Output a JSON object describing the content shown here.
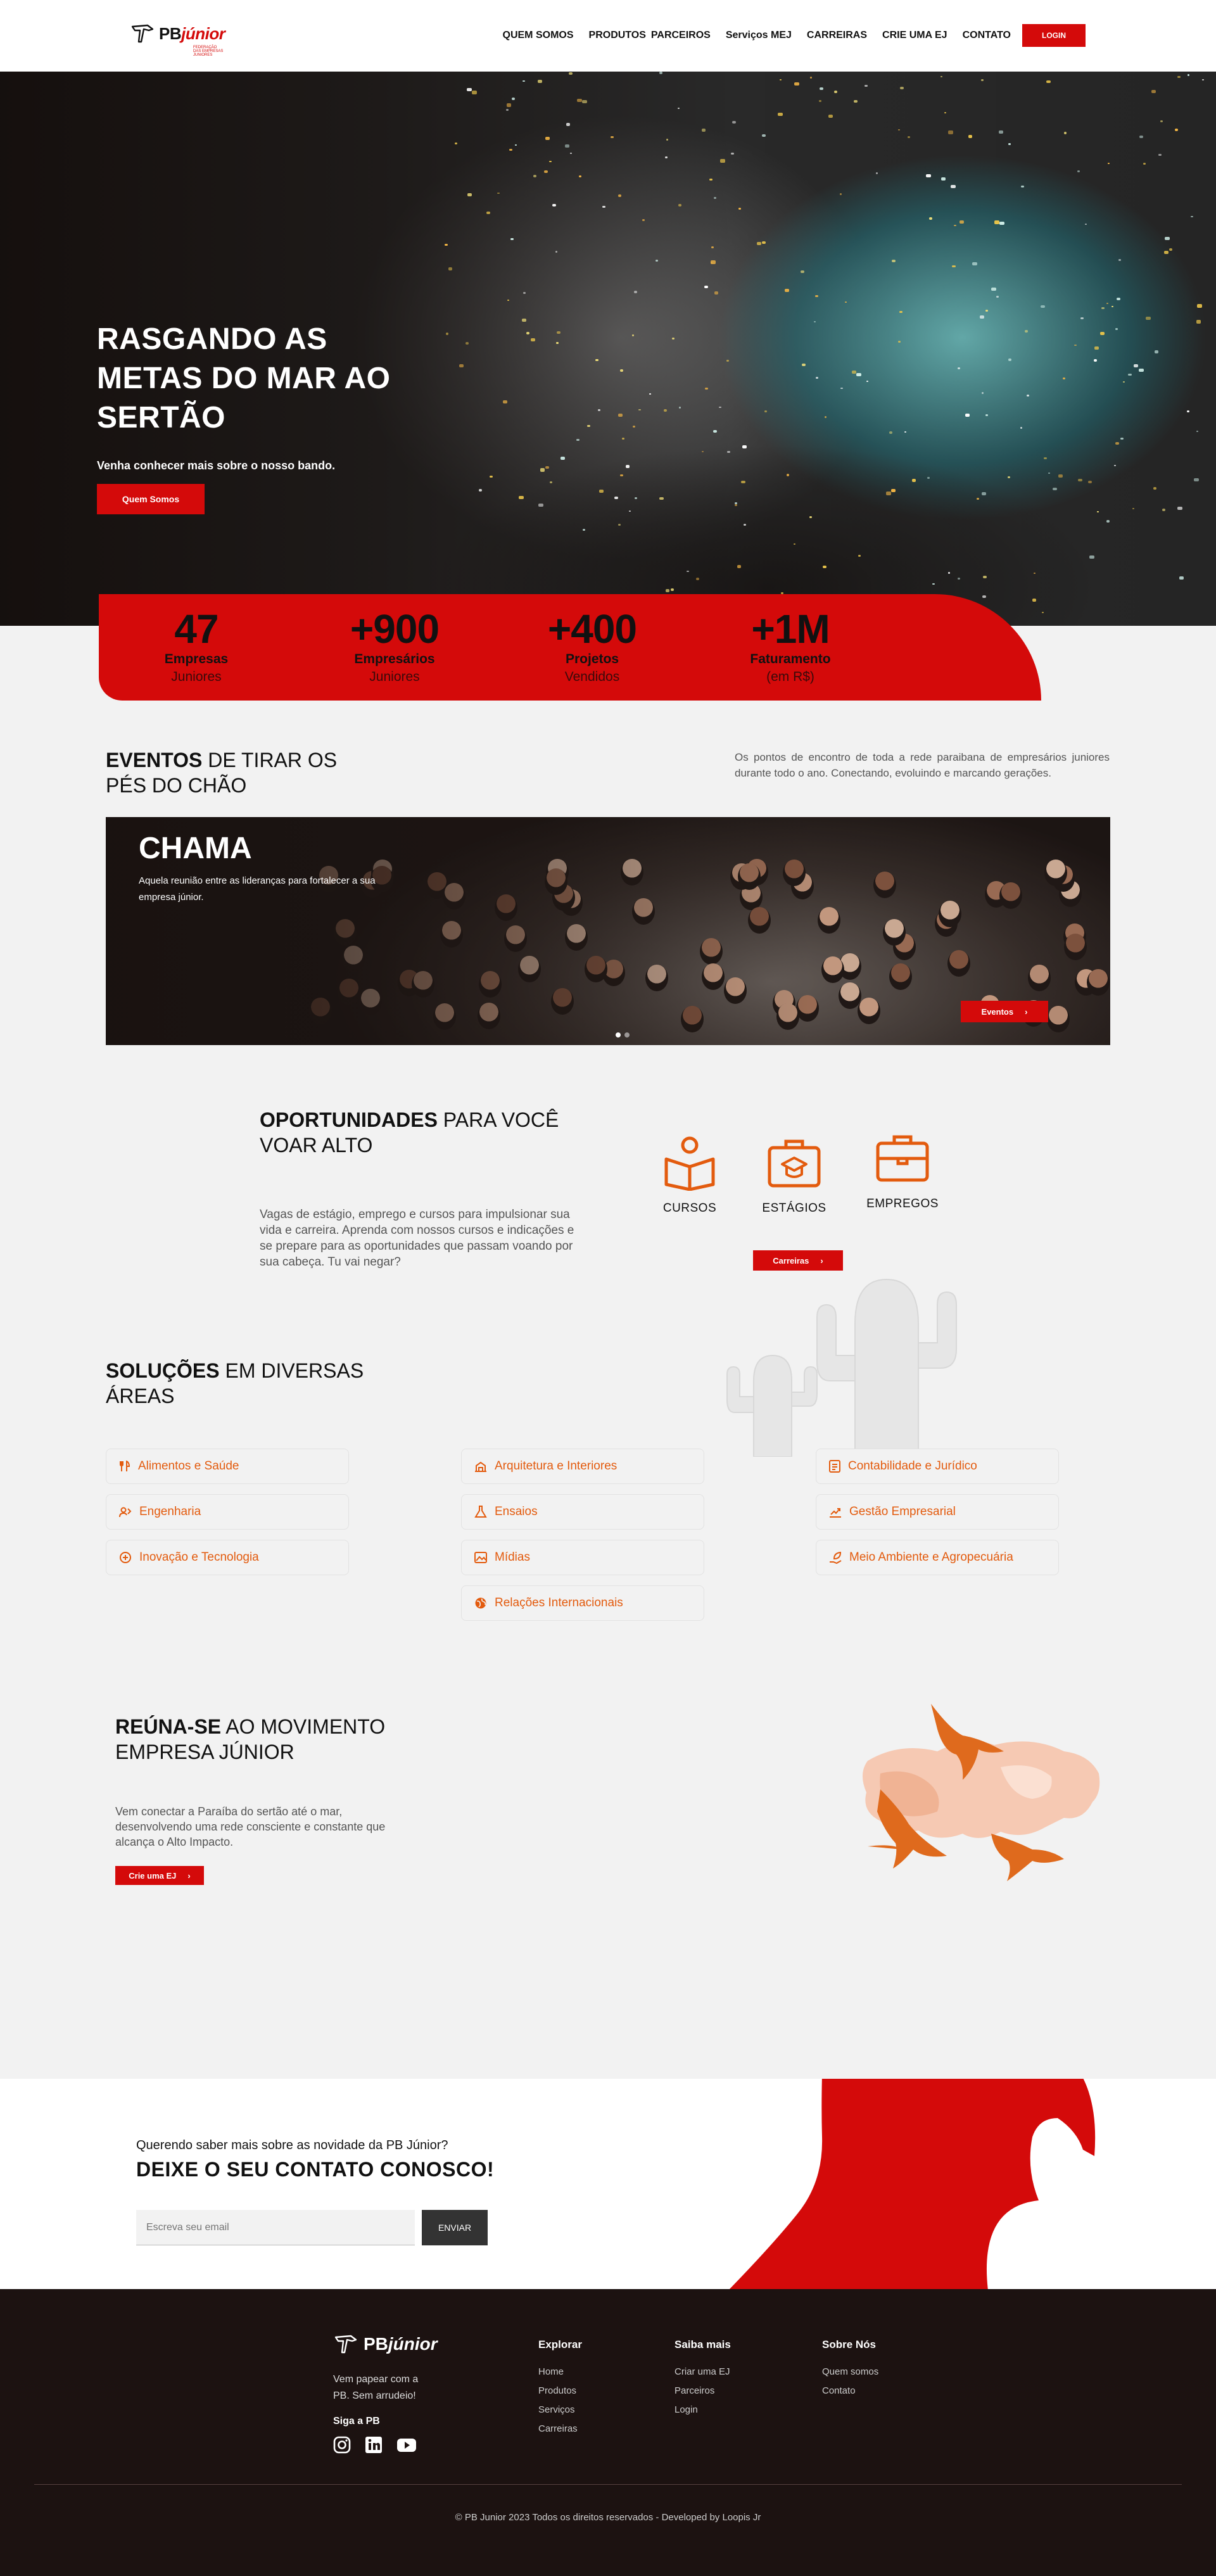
{
  "header": {
    "logo_text": "PB",
    "logo_accent": "júnior",
    "logo_tagline": "FEDERAÇÃO DAS EMPRESAS JUNIORES",
    "nav": [
      "QUEM SOMOS",
      "PRODUTOS",
      "PARCEIROS",
      "Serviços MEJ",
      "CARREIRAS",
      "CRIE UMA EJ",
      "CONTATO"
    ],
    "login": "LOGIN"
  },
  "hero": {
    "title": "RASGANDO AS METAS DO MAR AO SERTÃO",
    "subtitle": "Venha conhecer mais sobre o nosso bando.",
    "button": "Quem Somos"
  },
  "stats": [
    {
      "num": "47",
      "l1": "Empresas",
      "l2": "Juniores"
    },
    {
      "num": "+900",
      "l1": "Empresários",
      "l2": "Juniores"
    },
    {
      "num": "+400",
      "l1": "Projetos",
      "l2": "Vendidos"
    },
    {
      "num": "+1M",
      "l1": "Faturamento",
      "l2": "(em R$)"
    }
  ],
  "eventos": {
    "title_bold": "EVENTOS",
    "title_rest": " DE TIRAR OS PÉS DO CHÃO",
    "description": "Os pontos de encontro de toda a rede paraibana de empresários juniores durante todo o ano. Conectando, evoluindo e marcando gerações.",
    "slide_title": "CHAMA",
    "slide_text": "Aquela reunião entre as lideranças para fortalecer a sua empresa júnior.",
    "slide_button": "Eventos"
  },
  "oportunidades": {
    "title_bold": "OPORTUNIDADES",
    "title_rest": " PARA VOCÊ VOAR ALTO",
    "description": "Vagas de estágio, emprego e cursos para impulsionar sua vida e carreira. Aprenda com nossos cursos e indicações e se prepare para as oportunidades que passam voando por sua cabeça. Tu vai negar?",
    "items": [
      "CURSOS",
      "ESTÁGIOS",
      "EMPREGOS"
    ],
    "button": "Carreiras"
  },
  "solucoes": {
    "title_bold": "SOLUÇÕES",
    "title_rest": " EM DIVERSAS ÁREAS",
    "items": [
      "Alimentos e Saúde",
      "Engenharia",
      "Inovação e Tecnologia",
      "Arquitetura e Interiores",
      "Ensaios",
      "Mídias",
      "Relações Internacionais",
      "Contabilidade e Jurídico",
      "Gestão Empresarial",
      "Meio Ambiente e Agropecuária"
    ]
  },
  "reuna": {
    "title_bold": "REÚNA-SE",
    "title_rest": " AO MOVIMENTO EMPRESA JÚNIOR",
    "description": "Vem conectar a Paraíba do sertão até o mar, desenvolvendo uma rede consciente e constante que alcança o Alto Impacto.",
    "button": "Crie uma EJ"
  },
  "contato": {
    "question": "Querendo saber mais sobre as novidade da PB Júnior?",
    "title": "DEIXE O SEU CONTATO CONOSCO!",
    "email_placeholder": "Escreva seu email",
    "send": "ENVIAR"
  },
  "footer": {
    "logo_text": "PB",
    "logo_accent": "júnior",
    "intro": "Vem papear com a PB. Sem arrudeio!",
    "follow": "Siga a PB",
    "socials": [
      "instagram-icon",
      "linkedin-icon",
      "youtube-icon"
    ],
    "cols": [
      {
        "title": "Explorar",
        "links": [
          "Home",
          "Produtos",
          "Serviços",
          "Carreiras"
        ]
      },
      {
        "title": "Saiba mais",
        "links": [
          "Criar uma EJ",
          "Parceiros",
          "Login"
        ]
      },
      {
        "title": "Sobre Nós",
        "links": [
          "Quem somos",
          "Contato"
        ]
      }
    ],
    "copyright": "© PB Junior 2023 Todos os direitos reservados - Developed by Loopis Jr"
  },
  "colors": {
    "brand_red": "#d40a0a",
    "accent_orange": "#e35b0e",
    "footer_bg": "#1c1211"
  }
}
